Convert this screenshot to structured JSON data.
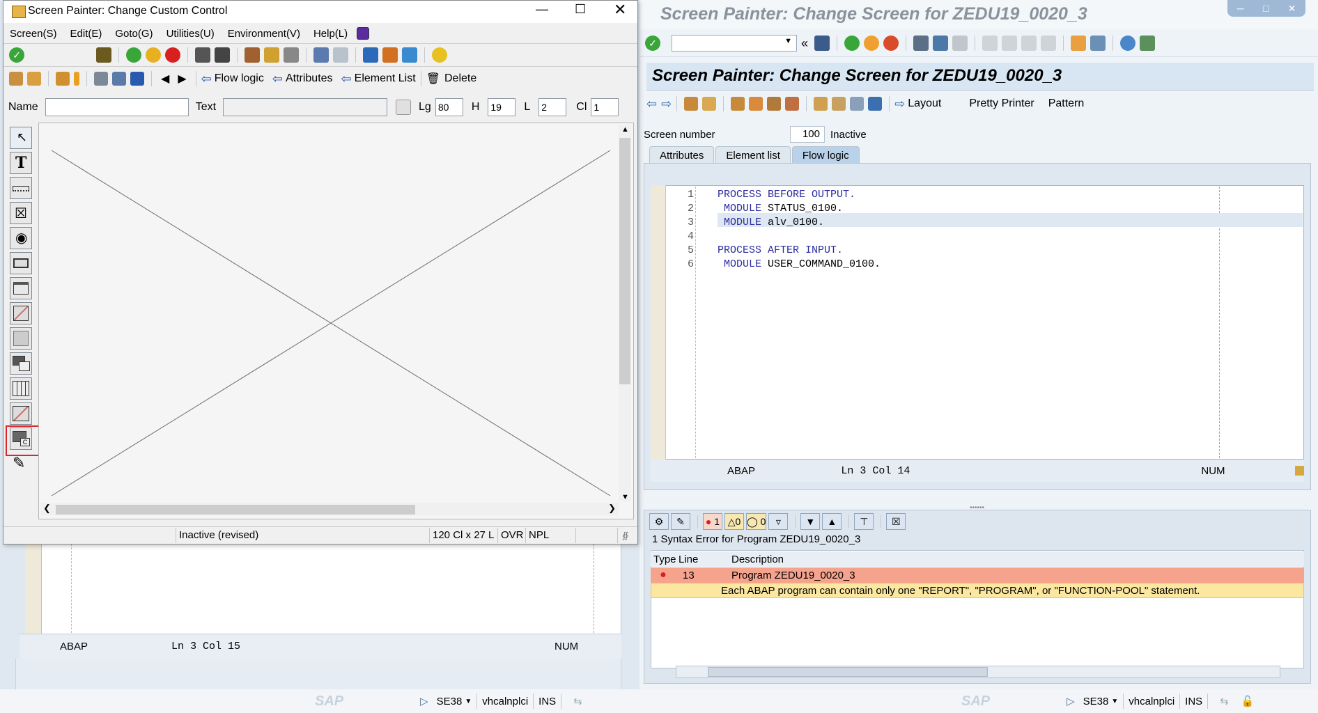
{
  "dialog": {
    "title": "Screen Painter:  Change Custom Control",
    "menu": [
      "Screen(S)",
      "Edit(E)",
      "Goto(G)",
      "Utilities(U)",
      "Environment(V)",
      "Help(L)"
    ],
    "toolbar2": {
      "flow_logic": "Flow logic",
      "attributes": "Attributes",
      "element_list": "Element List",
      "delete": "Delete"
    },
    "fields": {
      "name_label": "Name",
      "name_value": "",
      "text_label": "Text",
      "text_value": "",
      "lg_label": "Lg",
      "lg_value": "80",
      "h_label": "H",
      "h_value": "19",
      "l_label": "L",
      "l_value": "2",
      "cl_label": "Cl",
      "cl_value": "1"
    },
    "palette": [
      "pointer-icon",
      "text-field-icon",
      "input-field-icon",
      "checkbox-icon",
      "radio-button-icon",
      "pushbutton-icon",
      "tabstrip-icon",
      "tabstrip-wizard-icon",
      "box-icon",
      "subscreen-icon",
      "table-control-icon",
      "table-control-wizard-icon",
      "custom-control-icon",
      "status-icon"
    ],
    "status": {
      "state": "Inactive (revised)",
      "size": "120 Cl x 27 L",
      "mode": "OVR",
      "npl": "NPL"
    }
  },
  "background_left": {
    "status": {
      "lang": "ABAP",
      "pos": "Ln   3 Col  15",
      "num": "NUM"
    },
    "footer": {
      "tcode": "SE38",
      "server": "vhcalnplci",
      "mode": "INS"
    }
  },
  "right": {
    "title": "Screen Painter: Change Screen for ZEDU19_0020_3",
    "header": "Screen Painter: Change Screen for ZEDU19_0020_3",
    "app_bar": {
      "layout": "Layout",
      "pretty_printer": "Pretty Printer",
      "pattern": "Pattern"
    },
    "screen_number_label": "Screen number",
    "screen_number": "100",
    "screen_status": "Inactive",
    "tabs": [
      "Attributes",
      "Element list",
      "Flow logic"
    ],
    "active_tab": "Flow logic",
    "code": [
      {
        "n": "1",
        "kw": "PROCESS BEFORE OUTPUT.",
        "rest": ""
      },
      {
        "n": "2",
        "kw": " MODULE",
        "rest": " STATUS_0100."
      },
      {
        "n": "3",
        "kw": " MODULE",
        "rest": " alv_0100."
      },
      {
        "n": "4",
        "kw": "",
        "rest": ""
      },
      {
        "n": "5",
        "kw": "PROCESS AFTER INPUT.",
        "rest": ""
      },
      {
        "n": "6",
        "kw": " MODULE",
        "rest": " USER_COMMAND_0100."
      }
    ],
    "editor_status": {
      "lang": "ABAP",
      "pos": "Ln   3 Col  14",
      "num": "NUM"
    },
    "syntax": {
      "error_count": "1",
      "warning_count": "0",
      "info_count": "0",
      "title": "1 Syntax Error for Program ZEDU19_0020_3",
      "columns": [
        "Type",
        "Line",
        "Description"
      ],
      "row_line": "13",
      "row_desc": "Program ZEDU19_0020_3",
      "row_msg": "Each ABAP program can contain only one \"REPORT\", \"PROGRAM\", or \"FUNCTION-POOL\" statement."
    },
    "footer": {
      "tcode": "SE38",
      "server": "vhcalnplci",
      "mode": "INS"
    }
  },
  "colors": {
    "error_row": "#f6a38e",
    "message_row": "#fbe7a0",
    "highlight": "#e0242c",
    "header_bg": "#d8e5f2"
  }
}
